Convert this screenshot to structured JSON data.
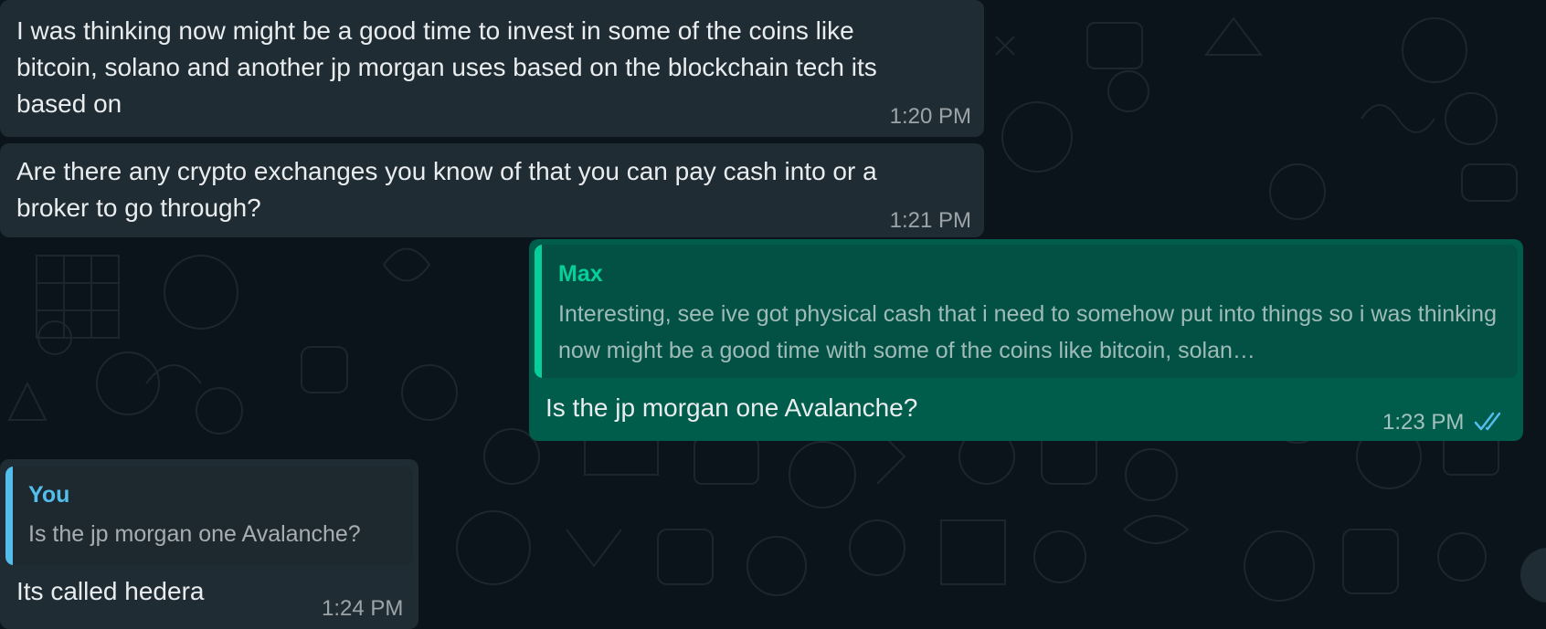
{
  "colors": {
    "background": "#0b141a",
    "incoming_bubble": "#202c33",
    "outgoing_bubble": "#005c4b",
    "quote_incoming_bg": "#1d282f",
    "quote_outgoing_bg": "#025144",
    "max_accent": "#06cf9c",
    "you_accent": "#53bdeb",
    "read_ticks": "#53bdeb"
  },
  "messages": [
    {
      "direction": "incoming",
      "text": "I was thinking now might be a good time to invest in some of the coins like bitcoin, solano and another jp morgan uses based on the blockchain tech its based on",
      "time": "1:20 PM"
    },
    {
      "direction": "incoming",
      "text": "Are there any crypto exchanges you know of that you can pay cash into or a broker to go through?",
      "time": "1:21 PM"
    },
    {
      "direction": "outgoing",
      "quote": {
        "author": "Max",
        "text": "Interesting, see ive got physical cash that i need to somehow put into things so i was thinking now might be a good time with some of the coins like bitcoin, solan…"
      },
      "text": "Is the jp morgan one Avalanche?",
      "time": "1:23 PM",
      "status_icon": "double-check-read-icon"
    },
    {
      "direction": "incoming",
      "quote": {
        "author": "You",
        "text": "Is the jp morgan one Avalanche?"
      },
      "text": "Its called hedera",
      "time": "1:24 PM"
    }
  ]
}
